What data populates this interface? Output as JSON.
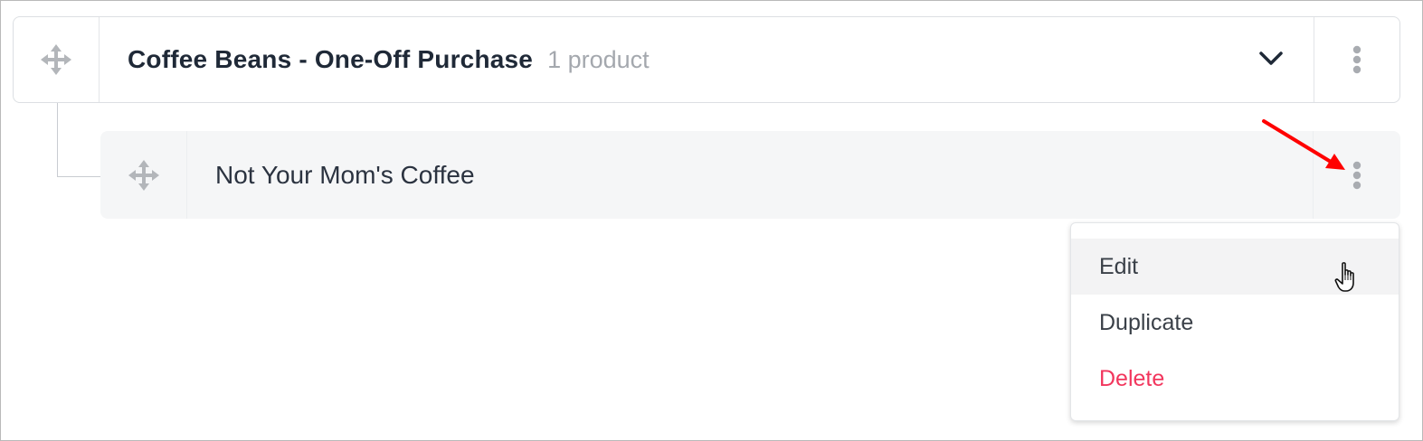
{
  "group": {
    "title": "Coffee Beans - One-Off Purchase",
    "count_label": "1 product",
    "icons": {
      "drag": "move-arrows-icon",
      "expand": "chevron-down-icon",
      "menu": "vertical-dots-icon"
    }
  },
  "child": {
    "title": "Not Your Mom's Coffee",
    "icons": {
      "drag": "move-arrows-icon",
      "menu": "vertical-dots-icon"
    }
  },
  "menu": {
    "items": [
      {
        "label": "Edit",
        "hovered": true
      },
      {
        "label": "Duplicate",
        "hovered": false
      },
      {
        "label": "Delete",
        "hovered": false,
        "danger": true
      }
    ]
  },
  "colors": {
    "title": "#1f2937",
    "muted": "#a4a8ae",
    "danger": "#f2365d",
    "annotation_arrow": "#ff0000",
    "child_row_bg": "#f5f6f7"
  }
}
